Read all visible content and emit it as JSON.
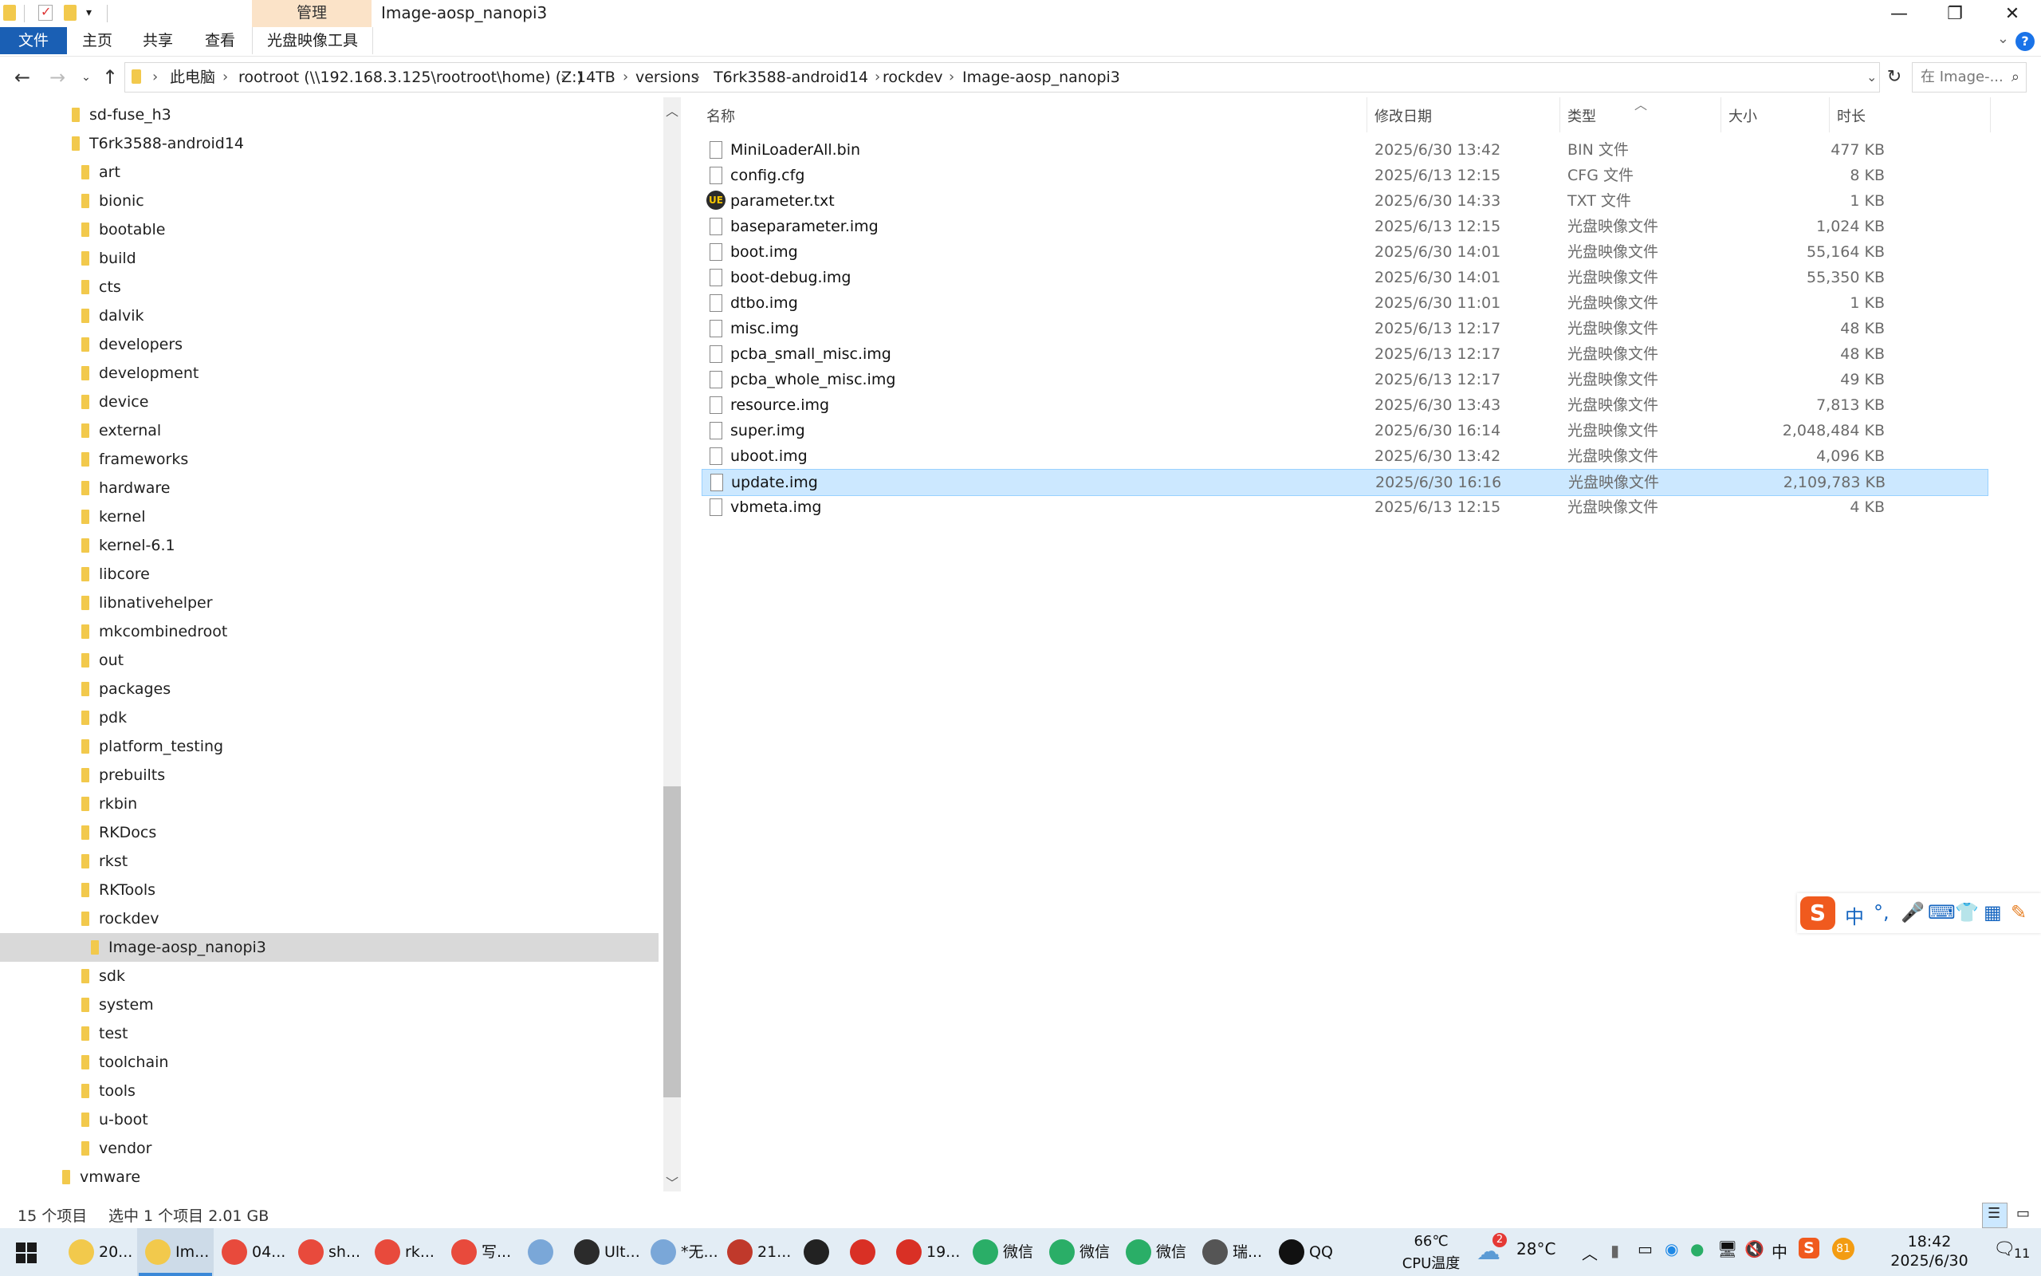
{
  "window": {
    "title": "Image-aosp_nanopi3",
    "manage_tab": "管理",
    "minimize": "—",
    "maximize": "❐",
    "close": "✕"
  },
  "ribbon": {
    "tabs": [
      "文件",
      "主页",
      "共享",
      "查看",
      "光盘映像工具"
    ],
    "help": "?"
  },
  "address": {
    "crumbs": [
      "此电脑",
      "rootroot (\\\\192.168.3.125\\rootroot\\home) (Z:)",
      "14TB",
      "versions",
      "T6rk3588-android14",
      "rockdev",
      "Image-aosp_nanopi3"
    ],
    "search_placeholder": "在 Image-..."
  },
  "tree": {
    "items": [
      {
        "label": "sd-fuse_h3",
        "level": 0
      },
      {
        "label": "T6rk3588-android14",
        "level": 0
      },
      {
        "label": "art",
        "level": 1
      },
      {
        "label": "bionic",
        "level": 1
      },
      {
        "label": "bootable",
        "level": 1
      },
      {
        "label": "build",
        "level": 1
      },
      {
        "label": "cts",
        "level": 1
      },
      {
        "label": "dalvik",
        "level": 1
      },
      {
        "label": "developers",
        "level": 1
      },
      {
        "label": "development",
        "level": 1
      },
      {
        "label": "device",
        "level": 1
      },
      {
        "label": "external",
        "level": 1
      },
      {
        "label": "frameworks",
        "level": 1
      },
      {
        "label": "hardware",
        "level": 1
      },
      {
        "label": "kernel",
        "level": 1
      },
      {
        "label": "kernel-6.1",
        "level": 1
      },
      {
        "label": "libcore",
        "level": 1
      },
      {
        "label": "libnativehelper",
        "level": 1
      },
      {
        "label": "mkcombinedroot",
        "level": 1
      },
      {
        "label": "out",
        "level": 1
      },
      {
        "label": "packages",
        "level": 1
      },
      {
        "label": "pdk",
        "level": 1
      },
      {
        "label": "platform_testing",
        "level": 1
      },
      {
        "label": "prebuilts",
        "level": 1
      },
      {
        "label": "rkbin",
        "level": 1
      },
      {
        "label": "RKDocs",
        "level": 1
      },
      {
        "label": "rkst",
        "level": 1
      },
      {
        "label": "RKTools",
        "level": 1
      },
      {
        "label": "rockdev",
        "level": 1
      },
      {
        "label": "Image-aosp_nanopi3",
        "level": 2,
        "selected": true
      },
      {
        "label": "sdk",
        "level": 1
      },
      {
        "label": "system",
        "level": 1
      },
      {
        "label": "test",
        "level": 1
      },
      {
        "label": "toolchain",
        "level": 1
      },
      {
        "label": "tools",
        "level": 1
      },
      {
        "label": "u-boot",
        "level": 1
      },
      {
        "label": "vendor",
        "level": 1
      },
      {
        "label": "vmware",
        "level": -1
      }
    ]
  },
  "columns": {
    "name": "名称",
    "date": "修改日期",
    "type": "类型",
    "size": "大小",
    "duration": "时长"
  },
  "files": [
    {
      "name": "MiniLoaderAll.bin",
      "date": "2025/6/30 13:42",
      "type": "BIN 文件",
      "size": "477 KB"
    },
    {
      "name": "config.cfg",
      "date": "2025/6/13 12:15",
      "type": "CFG 文件",
      "size": "8 KB"
    },
    {
      "name": "parameter.txt",
      "date": "2025/6/30 14:33",
      "type": "TXT 文件",
      "size": "1 KB",
      "icon": "ue"
    },
    {
      "name": "baseparameter.img",
      "date": "2025/6/13 12:15",
      "type": "光盘映像文件",
      "size": "1,024 KB"
    },
    {
      "name": "boot.img",
      "date": "2025/6/30 14:01",
      "type": "光盘映像文件",
      "size": "55,164 KB"
    },
    {
      "name": "boot-debug.img",
      "date": "2025/6/30 14:01",
      "type": "光盘映像文件",
      "size": "55,350 KB"
    },
    {
      "name": "dtbo.img",
      "date": "2025/6/30 11:01",
      "type": "光盘映像文件",
      "size": "1 KB"
    },
    {
      "name": "misc.img",
      "date": "2025/6/13 12:17",
      "type": "光盘映像文件",
      "size": "48 KB"
    },
    {
      "name": "pcba_small_misc.img",
      "date": "2025/6/13 12:17",
      "type": "光盘映像文件",
      "size": "48 KB"
    },
    {
      "name": "pcba_whole_misc.img",
      "date": "2025/6/13 12:17",
      "type": "光盘映像文件",
      "size": "49 KB"
    },
    {
      "name": "resource.img",
      "date": "2025/6/30 13:43",
      "type": "光盘映像文件",
      "size": "7,813 KB"
    },
    {
      "name": "super.img",
      "date": "2025/6/30 16:14",
      "type": "光盘映像文件",
      "size": "2,048,484 KB"
    },
    {
      "name": "uboot.img",
      "date": "2025/6/30 13:42",
      "type": "光盘映像文件",
      "size": "4,096 KB"
    },
    {
      "name": "update.img",
      "date": "2025/6/30 16:16",
      "type": "光盘映像文件",
      "size": "2,109,783 KB",
      "selected": true
    },
    {
      "name": "vbmeta.img",
      "date": "2025/6/13 12:15",
      "type": "光盘映像文件",
      "size": "4 KB"
    }
  ],
  "status": {
    "count": "15 个项目",
    "selection": "选中 1 个项目  2.01 GB"
  },
  "ime": {
    "logo": "S",
    "mode": "中",
    "punct": "°,"
  },
  "taskbar": {
    "items": [
      {
        "label": "20...",
        "color": "#f2c94c"
      },
      {
        "label": "Im...",
        "color": "#f2c94c",
        "active": true
      },
      {
        "label": "04...",
        "color": "#e84a3c"
      },
      {
        "label": "sh...",
        "color": "#e84a3c"
      },
      {
        "label": "rk...",
        "color": "#e84a3c"
      },
      {
        "label": "写...",
        "color": "#e84a3c"
      },
      {
        "label": "",
        "color": "#7aa7d8"
      },
      {
        "label": "Ult...",
        "color": "#2b2b2b"
      },
      {
        "label": "*无...",
        "color": "#7aa7d8"
      },
      {
        "label": "21...",
        "color": "#c0392b"
      },
      {
        "label": "",
        "color": "#222222"
      },
      {
        "label": "",
        "color": "#d93025"
      },
      {
        "label": "19...",
        "color": "#d93025"
      },
      {
        "label": "微信",
        "color": "#2aae67"
      },
      {
        "label": "微信",
        "color": "#2aae67"
      },
      {
        "label": "微信",
        "color": "#2aae67"
      },
      {
        "label": "瑞...",
        "color": "#555555"
      },
      {
        "label": "QQ",
        "color": "#111111"
      }
    ],
    "cpu_temp": "66℃",
    "cpu_label": "CPU温度",
    "weather_badge": "2",
    "weather": "28°C",
    "tray_badge": "81",
    "time": "18:42",
    "date": "2025/6/30",
    "notif": "11"
  }
}
